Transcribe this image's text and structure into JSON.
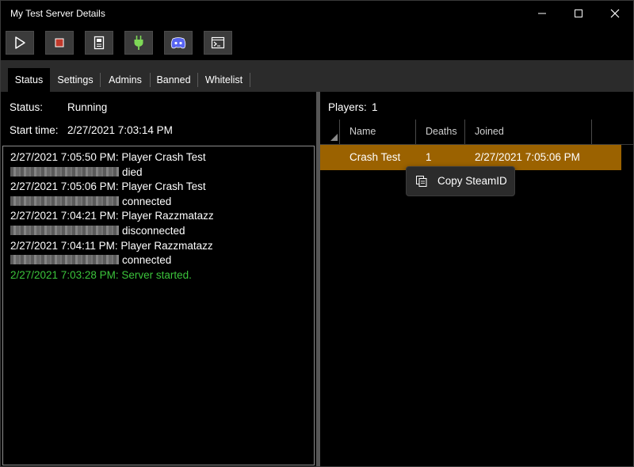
{
  "window": {
    "title": "My Test Server Details",
    "controls": [
      "minimize-icon",
      "maximize-icon",
      "close-icon"
    ]
  },
  "toolbar": {
    "buttons": [
      {
        "icon": "play-icon"
      },
      {
        "icon": "stop-icon",
        "color": "#c0392b"
      },
      {
        "icon": "notebook-icon"
      },
      {
        "icon": "plug-icon",
        "color": "#7ed957"
      },
      {
        "icon": "discord-icon",
        "color": "#5865f2"
      },
      {
        "icon": "terminal-icon"
      }
    ]
  },
  "tabs": [
    "Status",
    "Settings",
    "Admins",
    "Banned",
    "Whitelist"
  ],
  "active_tab": "Status",
  "status": {
    "status_label": "Status:",
    "status_value": "Running",
    "start_label": "Start time:",
    "start_value": "2/27/2021 7:03:14 PM"
  },
  "log": [
    {
      "text": "2/27/2021 7:05:50 PM: Player Crash Test"
    },
    {
      "redacted": true,
      "text": "died"
    },
    {
      "text": "2/27/2021 7:05:06 PM: Player Crash Test"
    },
    {
      "redacted": true,
      "text": "connected"
    },
    {
      "text": "2/27/2021 7:04:21 PM: Player Razzmatazz"
    },
    {
      "redacted": true,
      "text": "disconnected"
    },
    {
      "text": "2/27/2021 7:04:11 PM: Player Razzmatazz"
    },
    {
      "redacted": true,
      "text": "connected"
    },
    {
      "text": "2/27/2021 7:03:28 PM: Server started.",
      "color": "#3bc43b"
    }
  ],
  "players": {
    "label": "Players:",
    "count": "1",
    "columns": [
      "Name",
      "Deaths",
      "Joined"
    ],
    "rows": [
      {
        "name": "Crash Test",
        "deaths": "1",
        "joined": "2/27/2021 7:05:06 PM"
      }
    ],
    "selected_row_color": "#9b6200"
  },
  "context_menu": {
    "items": [
      {
        "label": "Copy SteamID",
        "icon": "copy-icon"
      }
    ]
  }
}
